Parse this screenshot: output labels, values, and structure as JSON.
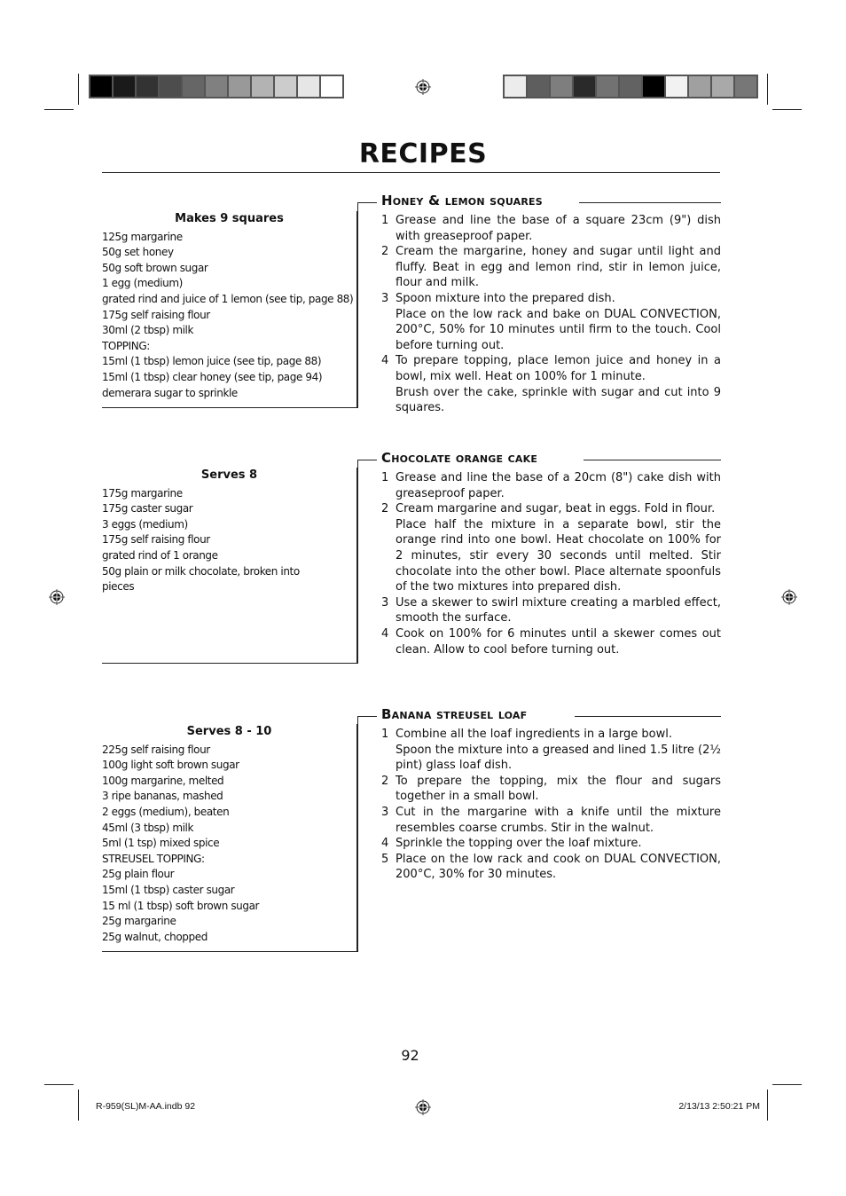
{
  "color_bar_left": [
    "#000000",
    "#1a1a1a",
    "#333333",
    "#4d4d4d",
    "#666666",
    "#808080",
    "#999999",
    "#b3b3b3",
    "#cccccc",
    "#e6e6e6",
    "#ffffff"
  ],
  "color_bar_right": [
    "#ececec",
    "#5e5e5e",
    "#7e7e7e",
    "#2a2a2a",
    "#727272",
    "#626262",
    "#000000",
    "#f2f2f2",
    "#a0a0a0",
    "#a9a9a9",
    "#777777"
  ],
  "page_title": "RECIPES",
  "recipes": [
    {
      "name": "Honey & lemon squares",
      "serves": "Makes 9 squares",
      "ingredients": [
        "125g margarine",
        "50g set honey",
        "50g soft brown sugar",
        "1 egg (medium)",
        "grated rind and juice of 1 lemon (see tip, page 88)",
        "175g self raising flour",
        "30ml (2 tbsp) milk",
        "TOPPING:",
        "15ml (1 tbsp) lemon juice (see tip, page 88)",
        "15ml (1 tbsp) clear honey (see tip, page 94)",
        "demerara sugar to sprinkle"
      ],
      "steps": [
        {
          "num": "1",
          "paras": [
            "Grease and line the base of a square 23cm (9\") dish with greaseproof paper."
          ]
        },
        {
          "num": "2",
          "paras": [
            "Cream the margarine, honey and sugar until light and fluffy. Beat in egg and lemon rind, stir in lemon juice, flour and milk."
          ]
        },
        {
          "num": "3",
          "paras": [
            "Spoon mixture into the prepared dish.",
            "Place on the low rack and bake on DUAL CONVECTION, 200°C, 50% for 10 minutes until firm to the touch. Cool before turning out."
          ]
        },
        {
          "num": "4",
          "paras": [
            "To prepare topping, place lemon juice and honey in a bowl, mix well. Heat on 100% for 1 minute.",
            "Brush over the cake, sprinkle with sugar and cut into 9 squares."
          ]
        }
      ]
    },
    {
      "name": "Chocolate orange cake",
      "serves": "Serves 8",
      "ingredients": [
        "175g margarine",
        "175g caster sugar",
        "3 eggs (medium)",
        "175g self raising flour",
        "grated rind of 1 orange",
        "50g plain or milk chocolate, broken into",
        "pieces"
      ],
      "steps": [
        {
          "num": "1",
          "paras": [
            "Grease and line the base of a 20cm (8\") cake dish with greaseproof paper."
          ]
        },
        {
          "num": "2",
          "paras": [
            "Cream margarine and sugar, beat in eggs. Fold in flour.",
            "Place half the mixture in a separate bowl, stir the orange rind into one bowl. Heat chocolate on 100% for 2 minutes, stir every 30 seconds until melted. Stir chocolate into the other bowl. Place alternate spoonfuls of the two mixtures into prepared dish."
          ]
        },
        {
          "num": "3",
          "paras": [
            "Use a skewer to swirl mixture creating a marbled effect, smooth the surface."
          ]
        },
        {
          "num": "4",
          "paras": [
            "Cook on 100% for 6 minutes until a skewer comes out clean. Allow to cool before turning out."
          ]
        }
      ]
    },
    {
      "name": "Banana streusel loaf",
      "serves": "Serves 8 - 10",
      "ingredients": [
        "225g self raising flour",
        "100g light soft brown sugar",
        "100g margarine, melted",
        "3 ripe bananas, mashed",
        "2 eggs (medium), beaten",
        "45ml (3 tbsp) milk",
        "5ml (1 tsp) mixed spice",
        "STREUSEL TOPPING:",
        "25g plain flour",
        "15ml (1 tbsp) caster sugar",
        "15 ml (1 tbsp) soft brown sugar",
        "25g margarine",
        "25g walnut, chopped"
      ],
      "steps": [
        {
          "num": "1",
          "paras": [
            "Combine all the loaf ingredients in a large bowl.",
            "Spoon the mixture into a greased and lined 1.5 litre (2½ pint) glass loaf dish."
          ]
        },
        {
          "num": "2",
          "paras": [
            "To prepare the topping, mix the flour and sugars together in a small bowl."
          ]
        },
        {
          "num": "3",
          "paras": [
            "Cut in the margarine with a knife until the mixture resembles coarse crumbs. Stir in the walnut."
          ]
        },
        {
          "num": "4",
          "paras": [
            "Sprinkle the topping over the loaf mixture."
          ]
        },
        {
          "num": "5",
          "paras": [
            "Place on the low rack and cook on DUAL CONVECTION, 200°C, 30% for 30 minutes."
          ]
        }
      ]
    }
  ],
  "page_number": "92",
  "footer": {
    "file": "R-959(SL)M-AA.indb   92",
    "timestamp": "2/13/13   2:50:21 PM"
  },
  "icons": {
    "registration_mark": "crosshair-target"
  }
}
